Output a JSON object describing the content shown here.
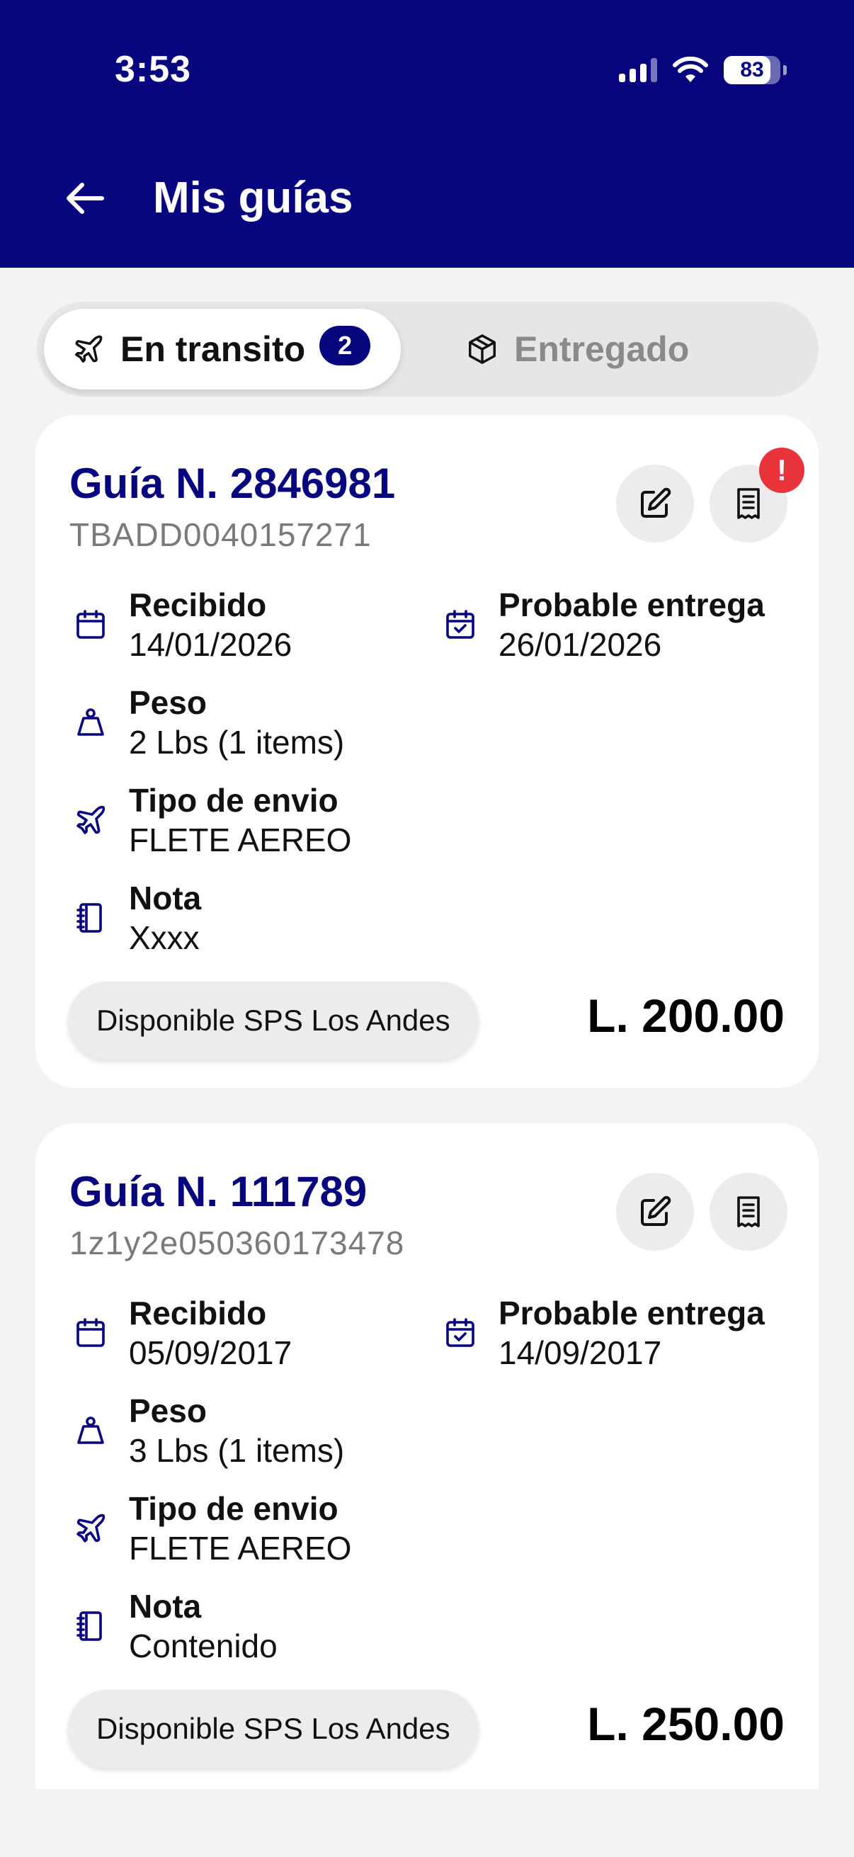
{
  "status_bar": {
    "time": "3:53",
    "battery": "83",
    "battery_percent": 83
  },
  "header": {
    "title": "Mis guías"
  },
  "tabs": [
    {
      "label": "En transito",
      "badge": "2",
      "active": true
    },
    {
      "label": "Entregado",
      "active": false
    }
  ],
  "icons": {
    "back": "arrow-left-icon",
    "tab_transit": "airplane-icon",
    "tab_delivered": "package-icon",
    "edit": "edit-icon",
    "receipt": "receipt-icon",
    "received": "calendar-icon",
    "delivery": "calendar-check-icon",
    "weight": "weight-icon",
    "shipping": "airplane-icon",
    "note": "notebook-icon"
  },
  "colors": {
    "brand": "#07067f",
    "alert": "#e8333a",
    "muted": "#7a7a7a"
  },
  "cards": [
    {
      "title": "Guía N. 2846981",
      "tracking": "TBADD0040157271",
      "alert": "!",
      "received_label": "Recibido",
      "received_value": "14/01/2026",
      "delivery_label": "Probable entrega",
      "delivery_value": "26/01/2026",
      "weight_label": "Peso",
      "weight_value": "2 Lbs (1 items)",
      "shipping_label": "Tipo de envio",
      "shipping_value": "FLETE AEREO",
      "note_label": "Nota",
      "note_value": "Xxxx",
      "status": "Disponible SPS Los Andes",
      "price": "L. 200.00"
    },
    {
      "title": "Guía N. 111789",
      "tracking": "1z1y2e050360173478",
      "received_label": "Recibido",
      "received_value": "05/09/2017",
      "delivery_label": "Probable entrega",
      "delivery_value": "14/09/2017",
      "weight_label": "Peso",
      "weight_value": "3 Lbs (1 items)",
      "shipping_label": "Tipo de envio",
      "shipping_value": "FLETE AEREO",
      "note_label": "Nota",
      "note_value": "Contenido",
      "status": "Disponible SPS Los Andes",
      "price": "L. 250.00"
    }
  ]
}
